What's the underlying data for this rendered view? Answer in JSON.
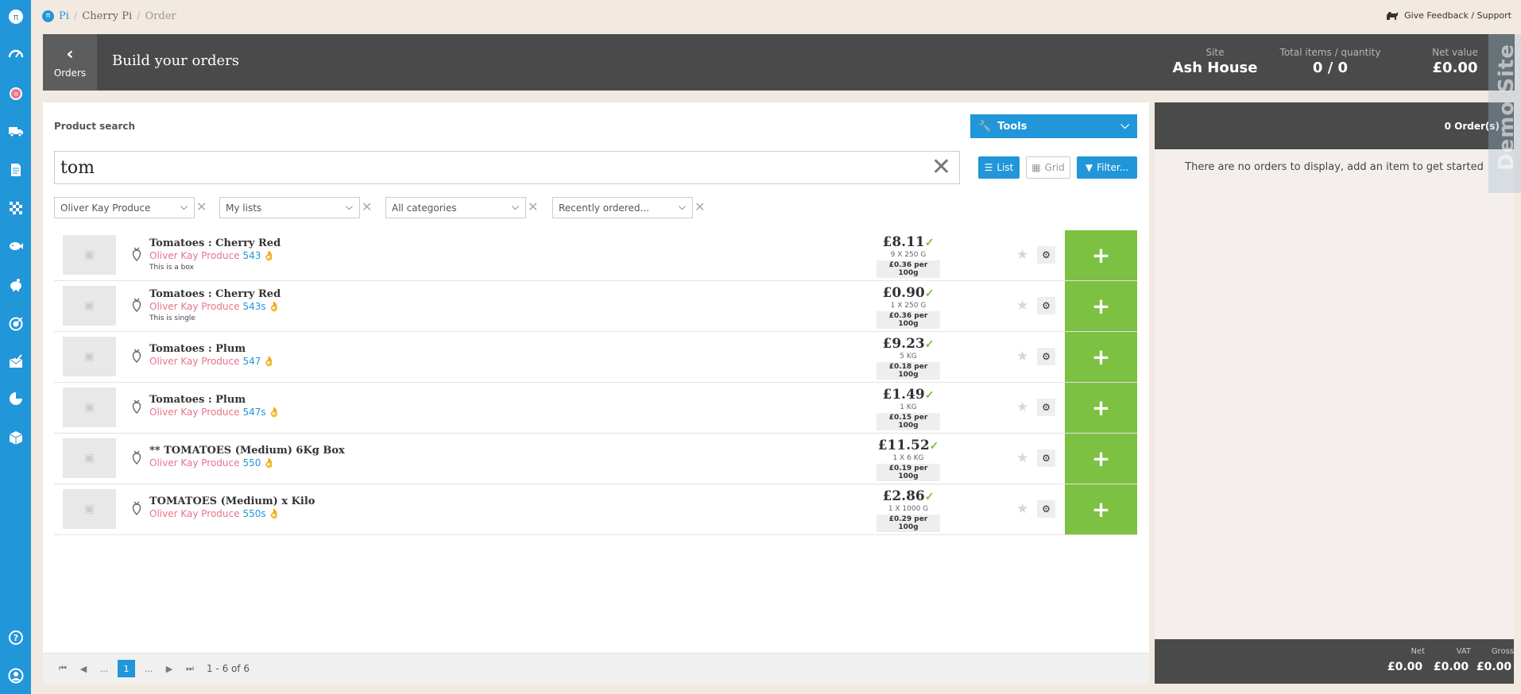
{
  "nav": {
    "icons": [
      "pi-logo-icon",
      "speedometer-icon",
      "pi-apple-icon",
      "truck-icon",
      "document-icon",
      "checkerboard-icon",
      "fish-icon",
      "piggy-bank-icon",
      "target-icon",
      "envelope-icon",
      "pie-chart-icon",
      "box-icon",
      "help-icon",
      "user-icon"
    ]
  },
  "breadcrumb": {
    "root": "Pi",
    "parent": "Cherry Pi",
    "current": "Order",
    "sep": "/"
  },
  "feedback": {
    "label": "Give Feedback / Support"
  },
  "header": {
    "back_label": "Orders",
    "back_chevron": "‹",
    "title": "Build your orders",
    "site_key": "Site",
    "site_value": "Ash House",
    "items_key": "Total items / quantity",
    "items_value": "0 / 0",
    "net_key": "Net value",
    "net_value": "£0.00",
    "demo": "Demo Site"
  },
  "search": {
    "label": "Product search",
    "value": "tom",
    "clear": "✕",
    "tools": "Tools",
    "list": "List",
    "grid": "Grid",
    "filter": "Filter...",
    "filters": [
      "Oliver Kay Produce",
      "My lists",
      "All categories",
      "Recently ordered..."
    ],
    "remove": "✕",
    "caret": "⌵"
  },
  "products": [
    {
      "name": "Tomatoes : Cherry Red",
      "supplier": "Oliver Kay Produce",
      "code": "543",
      "note": "This is a box",
      "price": "£8.11",
      "pack": "9 X 250 G",
      "per": "£0.36 per 100g"
    },
    {
      "name": "Tomatoes : Cherry Red",
      "supplier": "Oliver Kay Produce",
      "code": "543s",
      "note": "This is single",
      "price": "£0.90",
      "pack": "1 X 250 G",
      "per": "£0.36 per 100g"
    },
    {
      "name": "Tomatoes : Plum",
      "supplier": "Oliver Kay Produce",
      "code": "547",
      "note": "",
      "price": "£9.23",
      "pack": "5 KG",
      "per": "£0.18 per 100g"
    },
    {
      "name": "Tomatoes : Plum",
      "supplier": "Oliver Kay Produce",
      "code": "547s",
      "note": "",
      "price": "£1.49",
      "pack": "1 KG",
      "per": "£0.15 per 100g"
    },
    {
      "name": "** TOMATOES (Medium) 6Kg Box",
      "supplier": "Oliver Kay Produce",
      "code": "550",
      "note": "",
      "price": "£11.52",
      "pack": "1 X 6 KG",
      "per": "£0.19 per 100g"
    },
    {
      "name": "TOMATOES (Medium) x Kilo",
      "supplier": "Oliver Kay Produce",
      "code": "550s",
      "note": "",
      "price": "£2.86",
      "pack": "1 X 1000 G",
      "per": "£0.29 per 100g"
    }
  ],
  "row_glyphs": {
    "tick": "✓",
    "star": "★",
    "add": "+",
    "hand": "👌",
    "cogs": "⚙"
  },
  "pager": {
    "first": "⏮",
    "prev": "◀",
    "ellipsis": "...",
    "current": "1",
    "next": "▶",
    "last": "⏭",
    "info": "1 - 6 of 6"
  },
  "orders": {
    "count": "0 Order(s)",
    "empty": "There are no orders to display, add an item to get started",
    "net_key": "Net",
    "net": "£0.00",
    "vat_key": "VAT",
    "vat": "£0.00",
    "gross_key": "Gross",
    "gross": "£0.00"
  },
  "colors": {
    "primary": "#2196d9",
    "add": "#7cc142",
    "supplier": "#e8738a",
    "dark": "#4a4a4a"
  }
}
